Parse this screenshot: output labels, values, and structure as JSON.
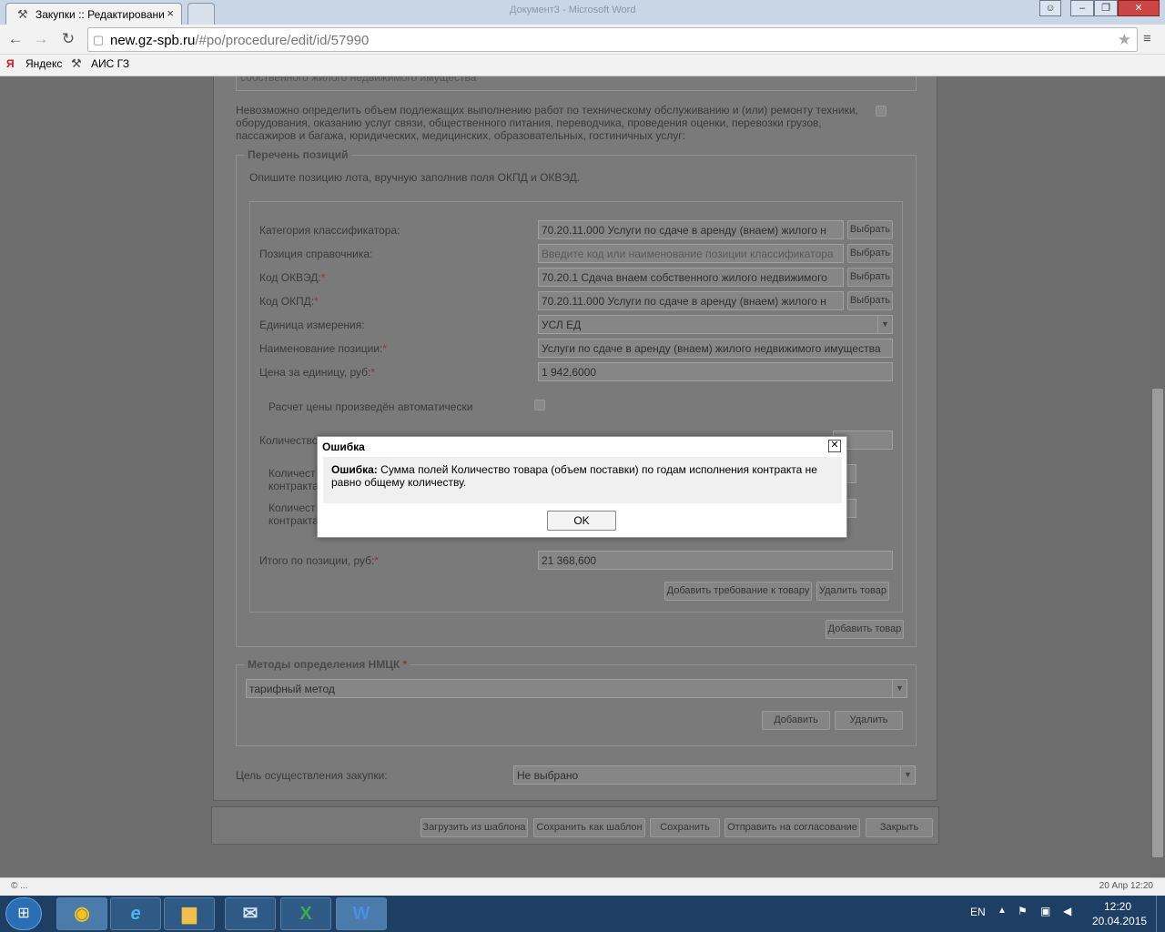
{
  "browser": {
    "tab_title": "Закупки :: Редактировани",
    "url_host": "new.gz-spb.ru",
    "url_path": "/#po/procedure/edit/id/57990",
    "bookmarks": [
      "Яндекс",
      "АИС ГЗ"
    ],
    "bg_window_title": "Документ3 - Microsoft Word"
  },
  "form": {
    "top_cut_text": "собственного жилого недвижимого имущества",
    "cannot_determine_label": "Невозможно определить объем подлежащих выполнению работ по техническому обслуживанию и (или) ремонту техники, оборудования, оказанию услуг связи, общественного питания, переводчика, проведения оценки, перевозки грузов, пассажиров и багажа, юридических, медицинских, образовательных, гостиничных услуг:",
    "positions_legend": "Перечень позиций",
    "positions_hint": "Опишите позицию лота, вручную заполнив поля ОКПД и ОКВЭД.",
    "choose_label": "Выбрать",
    "fields": {
      "category_label": "Категория классификатора:",
      "category_value": "70.20.11.000 Услуги по сдаче в аренду (внаем) жилого н",
      "ref_position_label": "Позиция справочника:",
      "ref_position_placeholder": "Введите код или наименование позиции классификатора",
      "okved_label": "Код ОКВЭД:",
      "okved_value": "70.20.1 Сдача внаем собственного жилого недвижимого",
      "okpd_label": "Код ОКПД:",
      "okpd_value": "70.20.11.000 Услуги по сдаче в аренду (внаем) жилого н",
      "unit_label": "Единица измерения:",
      "unit_value": "УСЛ ЕД",
      "name_label": "Наименование позиции:",
      "name_value": "Услуги по сдаче в аренду (внаем) жилого недвижимого имущества",
      "price_label": "Цена за единицу, руб:",
      "price_value": "1 942,6000",
      "auto_price_label": "Расчет цены произведён автоматически",
      "quantity_label": "Количество",
      "qty_year1_label_a": "Количест",
      "qty_year1_label_b": "контракта",
      "qty_year2_label_a": "Количест",
      "qty_year2_label_b": "контракта",
      "total_label": "Итого по позиции, руб:",
      "total_value": "21 368,600",
      "req_mark": "*"
    },
    "add_requirement_button": "Добавить требование к товару",
    "delete_item_button": "Удалить товар",
    "add_item_button": "Добавить товар",
    "nmck_legend": "Методы определения НМЦК",
    "nmck_value": "тарифный метод",
    "add_button": "Добавить",
    "delete_button": "Удалить",
    "purpose_label": "Цель осуществления закупки:",
    "purpose_value": "Не выбрано"
  },
  "footer_buttons": [
    "Загрузить из шаблона",
    "Сохранить как шаблон",
    "Сохранить",
    "Отправить на согласование",
    "Закрыть"
  ],
  "modal": {
    "title": "Ошибка",
    "bold_prefix": "Ошибка:",
    "message": " Сумма полей Количество товара (объем поставки) по годам исполнения контракта не равно общему количеству.",
    "ok_label": "OK"
  },
  "statusbar": {
    "left": "© ...",
    "right": "20 Апр 12:20"
  },
  "taskbar": {
    "lang": "EN",
    "time": "12:20",
    "date": "20.04.2015"
  }
}
